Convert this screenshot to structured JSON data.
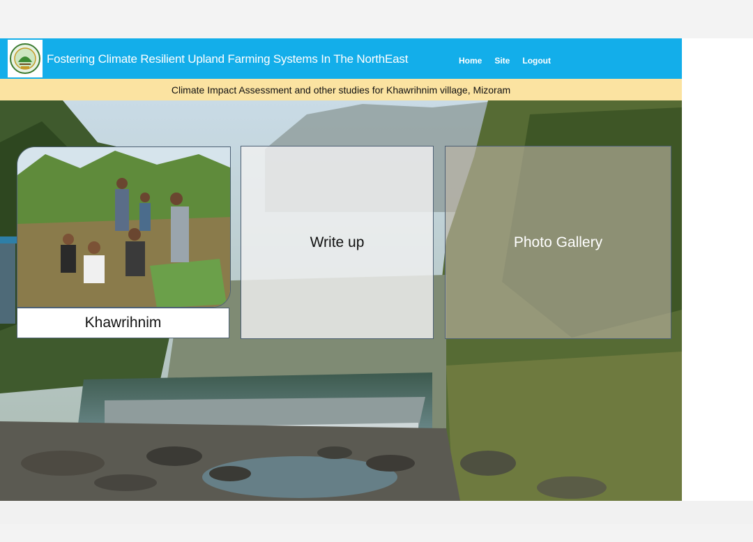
{
  "header": {
    "logo_icon": "fcrs-logo-icon",
    "title": "Fostering Climate Resilient Upland Farming Systems In The NorthEast",
    "nav": [
      {
        "label": "Home"
      },
      {
        "label": "Site"
      },
      {
        "label": "Logout"
      }
    ]
  },
  "subheader": {
    "text": "Climate Impact Assessment and other studies for Khawrihnim village, Mizoram"
  },
  "cards": [
    {
      "label": "Khawrihnim",
      "image": "field-team-photo"
    },
    {
      "label": "Write up"
    },
    {
      "label": "Photo Gallery"
    }
  ],
  "colors": {
    "navbar": "#13aeea",
    "subbar": "#fbe3a1",
    "card_border": "#4c5f73"
  }
}
